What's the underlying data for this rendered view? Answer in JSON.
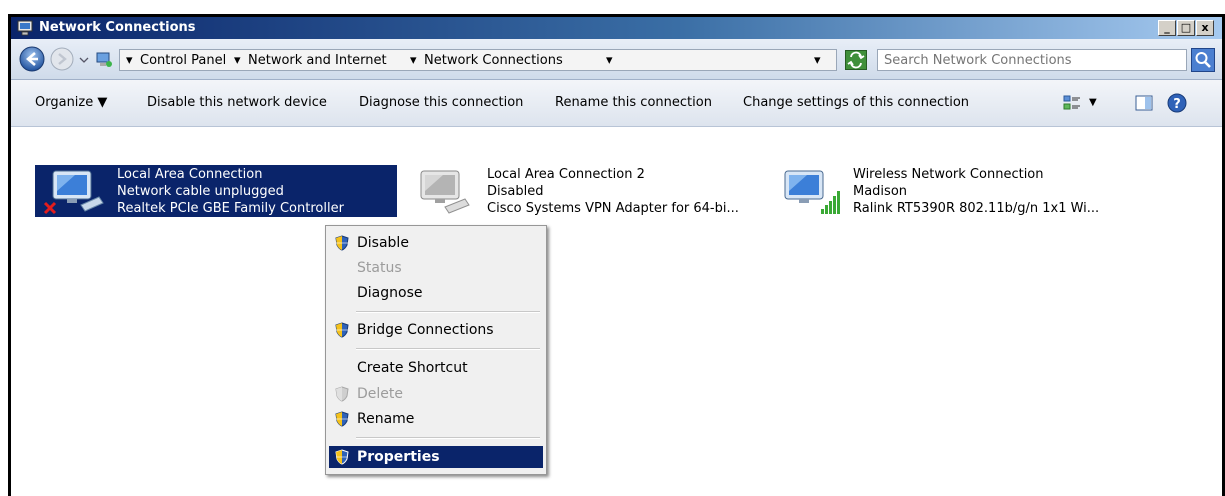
{
  "window": {
    "title": "Network Connections"
  },
  "address": {
    "crumbs": [
      "Control Panel",
      "Network and Internet",
      "Network Connections"
    ],
    "search_placeholder": "Search Network Connections"
  },
  "toolbar": {
    "organize": "Organize",
    "disable": "Disable this network device",
    "diagnose": "Diagnose this connection",
    "rename": "Rename this connection",
    "change": "Change settings of this connection"
  },
  "connections": [
    {
      "name": "Local Area Connection",
      "status": "Network cable unplugged",
      "device": "Realtek PCIe GBE Family Controller",
      "icon": "network-unplugged-icon"
    },
    {
      "name": "Local Area Connection 2",
      "status": "Disabled",
      "device": "Cisco Systems VPN Adapter for 64-bi...",
      "icon": "network-disabled-icon"
    },
    {
      "name": "Wireless Network Connection",
      "status": "Madison",
      "device": "Ralink RT5390R 802.11b/g/n 1x1 Wi...",
      "icon": "wireless-connection-icon"
    }
  ],
  "context_menu": {
    "items": [
      {
        "label": "Disable",
        "shield": true,
        "enabled": true
      },
      {
        "label": "Status",
        "shield": false,
        "enabled": false
      },
      {
        "label": "Diagnose",
        "shield": false,
        "enabled": true
      },
      {
        "label": "Bridge Connections",
        "shield": true,
        "enabled": true
      },
      {
        "label": "Create Shortcut",
        "shield": false,
        "enabled": true
      },
      {
        "label": "Delete",
        "shield": true,
        "enabled": false
      },
      {
        "label": "Rename",
        "shield": true,
        "enabled": true
      },
      {
        "label": "Properties",
        "shield": true,
        "enabled": true,
        "highlighted": true
      }
    ]
  },
  "colors": {
    "selection": "#0a246a",
    "titlebar_start": "#0a246a",
    "titlebar_end": "#a6caf0"
  }
}
